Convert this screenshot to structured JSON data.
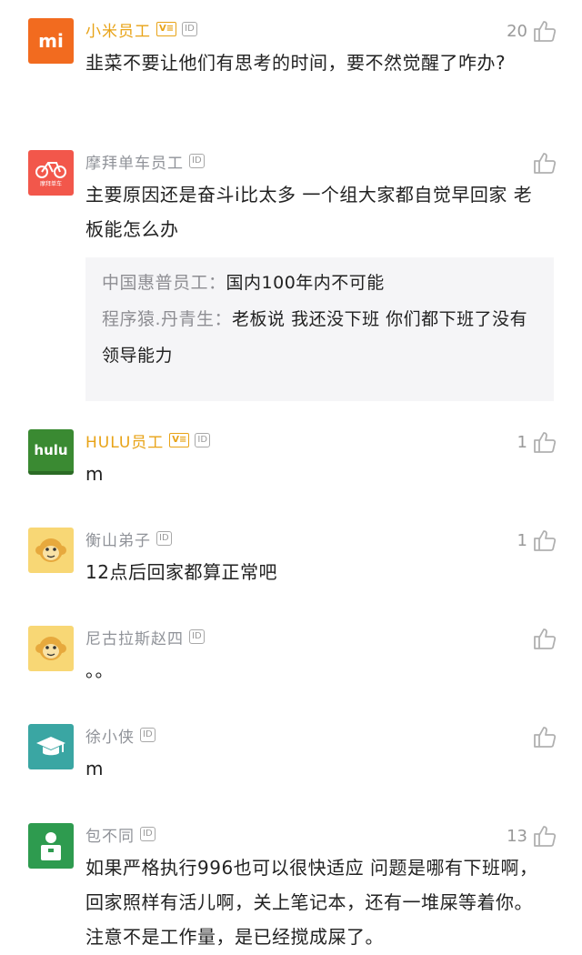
{
  "comments": [
    {
      "author": "小米员工",
      "verified": true,
      "badge_v": "V≡",
      "badge_id": "ID",
      "likes": "20",
      "text": "韭菜不要让他们有思考的时间，要不然觉醒了咋办?",
      "avatar": {
        "label": "mi",
        "icon": "xiaomi-logo",
        "bg": "#f26b1f"
      }
    },
    {
      "author": "摩拜单车员工",
      "verified": false,
      "badge_id": "ID",
      "likes": "",
      "text": "主要原因还是奋斗i比太多 一个组大家都自觉早回家 老板能怎么办",
      "avatar": {
        "label": "摩拜单车",
        "icon": "bike-icon",
        "bg": "#f2574b"
      },
      "replies": [
        {
          "name": "中国惠普员工：",
          "text": "国内100年内不可能"
        },
        {
          "name": "程序猿.丹青生：",
          "text": "老板说 我还没下班 你们都下班了没有领导能力"
        }
      ]
    },
    {
      "author": "HULU员工",
      "verified": true,
      "badge_v": "V≡",
      "badge_id": "ID",
      "likes": "1",
      "text": "m",
      "avatar": {
        "label": "hulu",
        "icon": "hulu-logo",
        "bg": "#3a8a32"
      }
    },
    {
      "author": "衡山弟子",
      "verified": false,
      "badge_id": "ID",
      "likes": "1",
      "text": "12点后回家都算正常吧",
      "avatar": {
        "label": "",
        "icon": "monkey-icon",
        "bg": "#f8d775"
      }
    },
    {
      "author": "尼古拉斯赵四",
      "verified": false,
      "badge_id": "ID",
      "likes": "",
      "text": "。。",
      "avatar": {
        "label": "",
        "icon": "monkey-icon",
        "bg": "#f8d775"
      }
    },
    {
      "author": "徐小侠",
      "verified": false,
      "badge_id": "ID",
      "likes": "",
      "text": "m",
      "avatar": {
        "label": "",
        "icon": "graduation-cap-icon",
        "bg": "#3aa6a3"
      }
    },
    {
      "author": "包不同",
      "verified": false,
      "badge_id": "ID",
      "likes": "13",
      "text": "如果严格执行996也可以很快适应 问题是哪有下班啊，回家照样有活儿啊，关上笔记本，还有一堆屎等着你。注意不是工作量，是已经搅成屎了。",
      "avatar": {
        "label": "",
        "icon": "person-icon",
        "bg": "#2e9b4f"
      }
    }
  ]
}
